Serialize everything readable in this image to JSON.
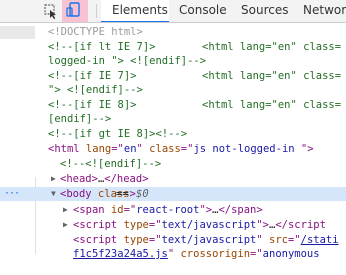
{
  "toolbar": {
    "inspect_icon": "cursor-inspect-icon",
    "device_icon": "device-toggle-icon",
    "tabs": [
      {
        "label": "Elements",
        "selected": true
      },
      {
        "label": "Console",
        "selected": false
      },
      {
        "label": "Sources",
        "selected": false
      },
      {
        "label": "Network",
        "selected": false
      }
    ]
  },
  "tree": {
    "doctype": "<!DOCTYPE html>",
    "cond1": {
      "comment_open": "<!--[if lt IE 7]>",
      "tag": "<html lang=\"en\" class=",
      "cont": "logged-in \"> <![endif]-->"
    },
    "cond2": {
      "comment_open": "<!--[if IE 7]>",
      "tag": "<html lang=\"en\" class=",
      "cont": "\"> <![endif]-->"
    },
    "cond3": {
      "comment_open": "<!--[if IE 8]>",
      "tag": "<html lang=\"en\" class=",
      "cont": "[endif]-->"
    },
    "cond4": "<!--[if gt IE 8]><!-->",
    "html": {
      "open": "<html",
      "lang_attr": " lang",
      "lang_eq": "=\"",
      "lang_val": "en",
      "class_q": "\"",
      "class_attr": " class",
      "class_eq": "=\"",
      "class_val": "js not-logged-in ",
      "close": "\">"
    },
    "endif_comment": "<!--<![endif]-->",
    "head": {
      "open": "<head>",
      "ellipsis": "…",
      "close": "</head>"
    },
    "body": {
      "dots": "···",
      "open": "<body",
      "class_attr": " class",
      "close": ">",
      "eq": "== ",
      "var": "$0"
    },
    "span": {
      "open": "<span",
      "id_attr": " id",
      "eq": "=\"",
      "id_val": "react-root",
      "close": "\">",
      "ellipsis": "…",
      "end": "</span>"
    },
    "script1": {
      "open": "<script",
      "type_attr": " type",
      "eq": "=\"",
      "type_val": "text/javascript",
      "close": "\">",
      "ellipsis": "…",
      "end": "</script"
    },
    "script2": {
      "open": "<script",
      "type_attr": " type",
      "eq": "=\"",
      "type_val": "text/javascript",
      "q": "\"",
      "src_attr": " src",
      "src_eq": "=\"",
      "src_val": "/stati"
    },
    "last_line": {
      "value": "f1c5f23a24a5.js",
      "q": "\"",
      "attr": " crossorigin",
      "eq": "=\"",
      "val": "anonymous"
    }
  }
}
